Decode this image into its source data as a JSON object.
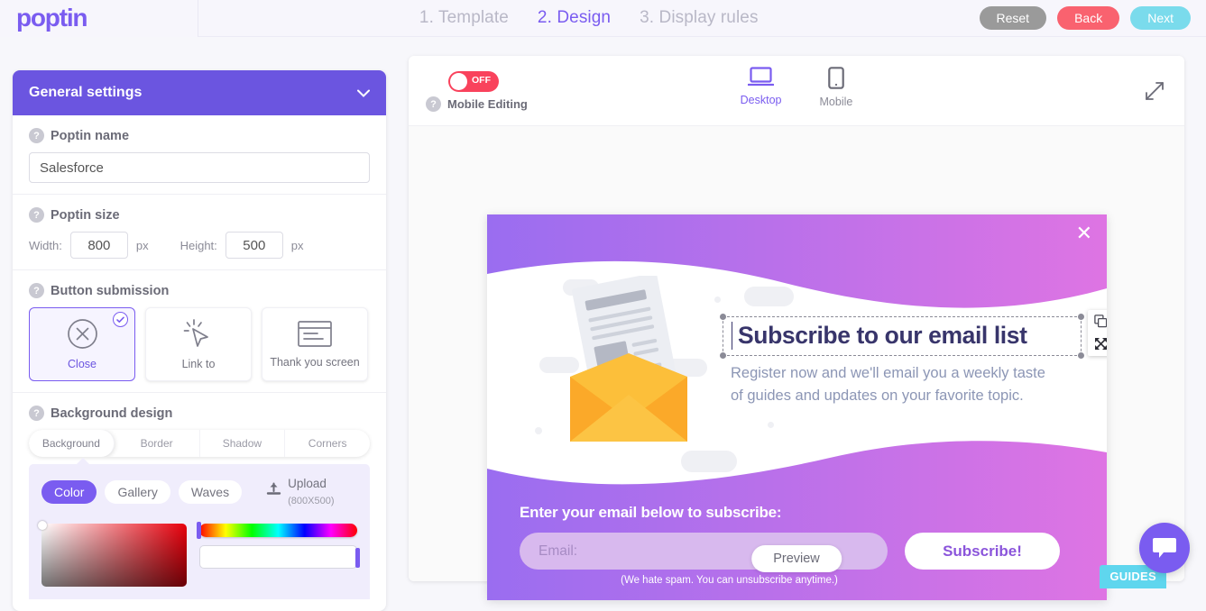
{
  "brand": {
    "logo_text": "poptin",
    "accent": "#7a5cf0"
  },
  "topbar": {
    "steps": [
      {
        "label": "1. Template",
        "active": false
      },
      {
        "label": "2. Design",
        "active": true
      },
      {
        "label": "3. Display rules",
        "active": false
      }
    ],
    "reset_label": "Reset",
    "back_label": "Back",
    "next_label": "Next",
    "reset_color": "#9a9a9a",
    "back_color": "#f9626f",
    "next_color": "#7adbec"
  },
  "sidebar": {
    "panel_title": "General settings",
    "chevron": "chevron-down-icon",
    "help_glyph": "?",
    "poptin_name": {
      "title": "Poptin name",
      "value": "Salesforce",
      "placeholder": "Poptin name"
    },
    "poptin_size": {
      "title": "Poptin size",
      "width_label": "Width:",
      "width_value": "800",
      "width_unit": "px",
      "height_label": "Height:",
      "height_value": "500",
      "height_unit": "px"
    },
    "button_submission": {
      "title": "Button submission",
      "options": [
        {
          "label": "Close",
          "icon": "circle-x-icon",
          "selected": true
        },
        {
          "label": "Link to",
          "icon": "cursor-click-icon",
          "selected": false
        },
        {
          "label": "Thank you screen",
          "icon": "window-lines-icon",
          "selected": false
        }
      ]
    },
    "background_design": {
      "title": "Background design",
      "tabs": [
        {
          "label": "Background",
          "active": true
        },
        {
          "label": "Border",
          "active": false
        },
        {
          "label": "Shadow",
          "active": false
        },
        {
          "label": "Corners",
          "active": false
        }
      ],
      "modes": [
        {
          "label": "Color",
          "active": true
        },
        {
          "label": "Gallery",
          "active": false
        },
        {
          "label": "Waves",
          "active": false
        }
      ],
      "upload_label": "Upload",
      "upload_size": "(800X500)",
      "upload_icon": "upload-icon"
    }
  },
  "canvas": {
    "mobile_editing": {
      "label": "Mobile Editing",
      "toggle_state": "OFF",
      "toggle_color": "#f9425c"
    },
    "devices": [
      {
        "label": "Desktop",
        "icon": "desktop-icon",
        "active": true
      },
      {
        "label": "Mobile",
        "icon": "mobile-icon",
        "active": false
      }
    ],
    "expand_icon": "expand-arrows-icon",
    "preview_label": "Preview"
  },
  "popup": {
    "close_icon": "close-x-icon",
    "illustration": "open-envelope-newsletter-icon",
    "headline": "Subscribe to our email list",
    "subcopy": "Register now and we'll email you a weekly taste of guides and updates on your favorite topic.",
    "form_title": "Enter your email below to subscribe:",
    "email_placeholder": "Email:",
    "submit_label": "Subscribe!",
    "spam_note": "(We hate spam. You can unsubscribe anytime.)",
    "selection_tools": [
      {
        "icon": "duplicate-icon"
      },
      {
        "icon": "move-icon"
      }
    ],
    "gradient_start": "#9a6df0",
    "gradient_end": "#de74e3",
    "headline_color": "#38356b",
    "subcopy_color": "#8c96b5",
    "email_field_color": "#d8b9ee",
    "submit_text_color": "#8b55db"
  },
  "footer": {
    "guides_label": "GUIDES",
    "guides_color": "#5fd6ee",
    "chat_icon": "chat-bubble-icon"
  }
}
